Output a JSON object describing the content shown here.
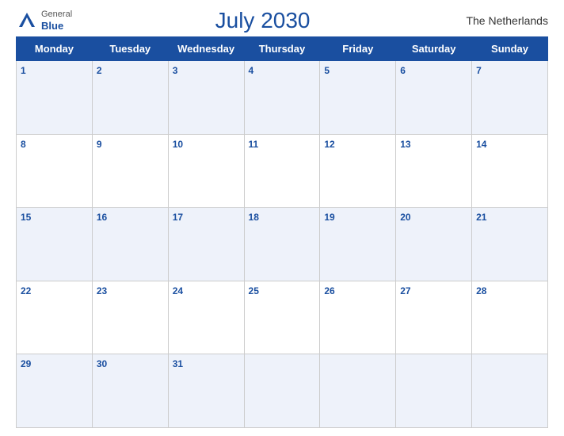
{
  "header": {
    "logo_general": "General",
    "logo_blue": "Blue",
    "title": "July 2030",
    "country": "The Netherlands"
  },
  "weekdays": [
    "Monday",
    "Tuesday",
    "Wednesday",
    "Thursday",
    "Friday",
    "Saturday",
    "Sunday"
  ],
  "weeks": [
    [
      {
        "day": "1",
        "active": true
      },
      {
        "day": "2",
        "active": true
      },
      {
        "day": "3",
        "active": true
      },
      {
        "day": "4",
        "active": true
      },
      {
        "day": "5",
        "active": true
      },
      {
        "day": "6",
        "active": true
      },
      {
        "day": "7",
        "active": true
      }
    ],
    [
      {
        "day": "8",
        "active": true
      },
      {
        "day": "9",
        "active": true
      },
      {
        "day": "10",
        "active": true
      },
      {
        "day": "11",
        "active": true
      },
      {
        "day": "12",
        "active": true
      },
      {
        "day": "13",
        "active": true
      },
      {
        "day": "14",
        "active": true
      }
    ],
    [
      {
        "day": "15",
        "active": true
      },
      {
        "day": "16",
        "active": true
      },
      {
        "day": "17",
        "active": true
      },
      {
        "day": "18",
        "active": true
      },
      {
        "day": "19",
        "active": true
      },
      {
        "day": "20",
        "active": true
      },
      {
        "day": "21",
        "active": true
      }
    ],
    [
      {
        "day": "22",
        "active": true
      },
      {
        "day": "23",
        "active": true
      },
      {
        "day": "24",
        "active": true
      },
      {
        "day": "25",
        "active": true
      },
      {
        "day": "26",
        "active": true
      },
      {
        "day": "27",
        "active": true
      },
      {
        "day": "28",
        "active": true
      }
    ],
    [
      {
        "day": "29",
        "active": true
      },
      {
        "day": "30",
        "active": true
      },
      {
        "day": "31",
        "active": true
      },
      {
        "day": "",
        "active": false
      },
      {
        "day": "",
        "active": false
      },
      {
        "day": "",
        "active": false
      },
      {
        "day": "",
        "active": false
      }
    ]
  ]
}
